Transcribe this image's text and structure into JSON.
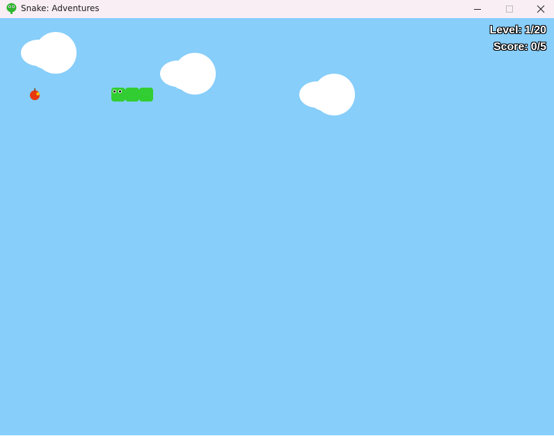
{
  "window": {
    "title": "Snake: Adventures",
    "app_icon": "snake-head-icon",
    "controls": [
      "minimize-icon",
      "maximize-icon",
      "close-icon"
    ]
  },
  "hud": {
    "level_label": "Level:",
    "level_value": "1/20",
    "score_label": "Score:",
    "score_value": "0/5"
  },
  "game": {
    "background_color": "#87cefa",
    "snake": {
      "color": "#32cd32",
      "direction": "left",
      "segments": 3
    },
    "food": {
      "type": "apple",
      "icon": "apple-icon",
      "color": "#e8380d"
    },
    "clouds": 3
  }
}
